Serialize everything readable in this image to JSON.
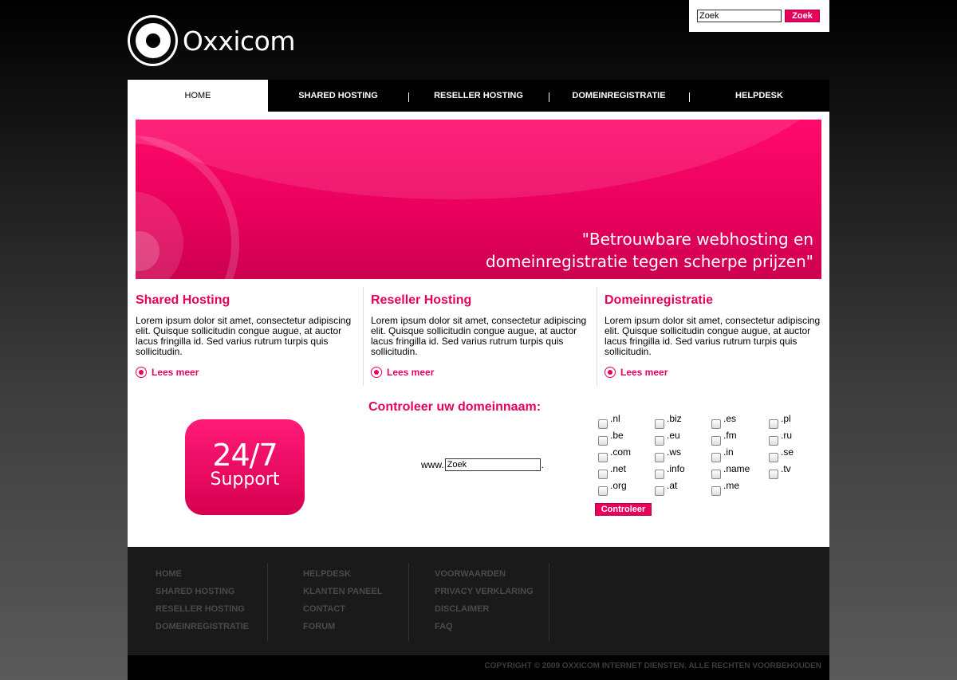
{
  "header": {
    "logo_text": "Oxxicom",
    "search": {
      "value": "Zoek",
      "button_label": "Zoek"
    }
  },
  "nav": {
    "items": [
      {
        "label": "HOME"
      },
      {
        "label": "SHARED HOSTING"
      },
      {
        "label": "RESELLER HOSTING"
      },
      {
        "label": "DOMEINREGISTRATIE"
      },
      {
        "label": "HELPDESK"
      }
    ],
    "active": "HOME"
  },
  "banner": {
    "quote_line1": "\"Betrouwbare webhosting en",
    "quote_line2": "domeinregistratie tegen scherpe prijzen\""
  },
  "columns": [
    {
      "title": "Shared Hosting",
      "body": "Lorem ipsum dolor sit amet, consectetur adipiscing elit. Quisque sollicitudin congue augue, at auctor lacus fringilla id. Sed varius rutrum turpis quis sollicitudin.",
      "more": "Lees meer"
    },
    {
      "title": "Reseller Hosting",
      "body": "Lorem ipsum dolor sit amet, consectetur adipiscing elit. Quisque sollicitudin congue augue, at auctor lacus fringilla id. Sed varius rutrum turpis quis sollicitudin.",
      "more": "Lees meer"
    },
    {
      "title": "Domeinregistratie",
      "body": "Lorem ipsum dolor sit amet, consectetur adipiscing elit. Quisque sollicitudin congue augue, at auctor lacus fringilla id. Sed varius rutrum turpis quis sollicitudin.",
      "more": "Lees meer"
    }
  ],
  "support": {
    "big": "24/7",
    "small": "Support"
  },
  "domain_check": {
    "title": "Controleer uw domeinnaam:",
    "prefix": "www.",
    "input_value": "Zoek",
    "suffix": ".",
    "tlds": [
      [
        ".nl",
        ".be",
        ".com",
        ".net",
        ".org"
      ],
      [
        ".biz",
        ".eu",
        ".ws",
        ".info",
        ".at"
      ],
      [
        ".es",
        ".fm",
        ".in",
        ".name",
        ".me"
      ],
      [
        ".pl",
        ".ru",
        ".se",
        ".tv"
      ]
    ],
    "button_label": "Controleer"
  },
  "footer": {
    "columns": [
      [
        "HOME",
        "SHARED HOSTING",
        "RESELLER HOSTING",
        "DOMEINREGISTRATIE"
      ],
      [
        "HELPDESK",
        "KLANTEN PANEEL",
        "CONTACT",
        "FORUM"
      ],
      [
        "VOORWAARDEN",
        "PRIVACY VERKLARING",
        "DISCLAIMER",
        "FAQ"
      ]
    ],
    "copyright": "COPYRIGHT © 2009 OXXICOM INTERNET DIENSTEN. ALLE RECHTEN VOORBEHOUDEN"
  },
  "colors": {
    "accent": "#e8005c",
    "background": "#000000",
    "footer": "#1a1a1a"
  }
}
